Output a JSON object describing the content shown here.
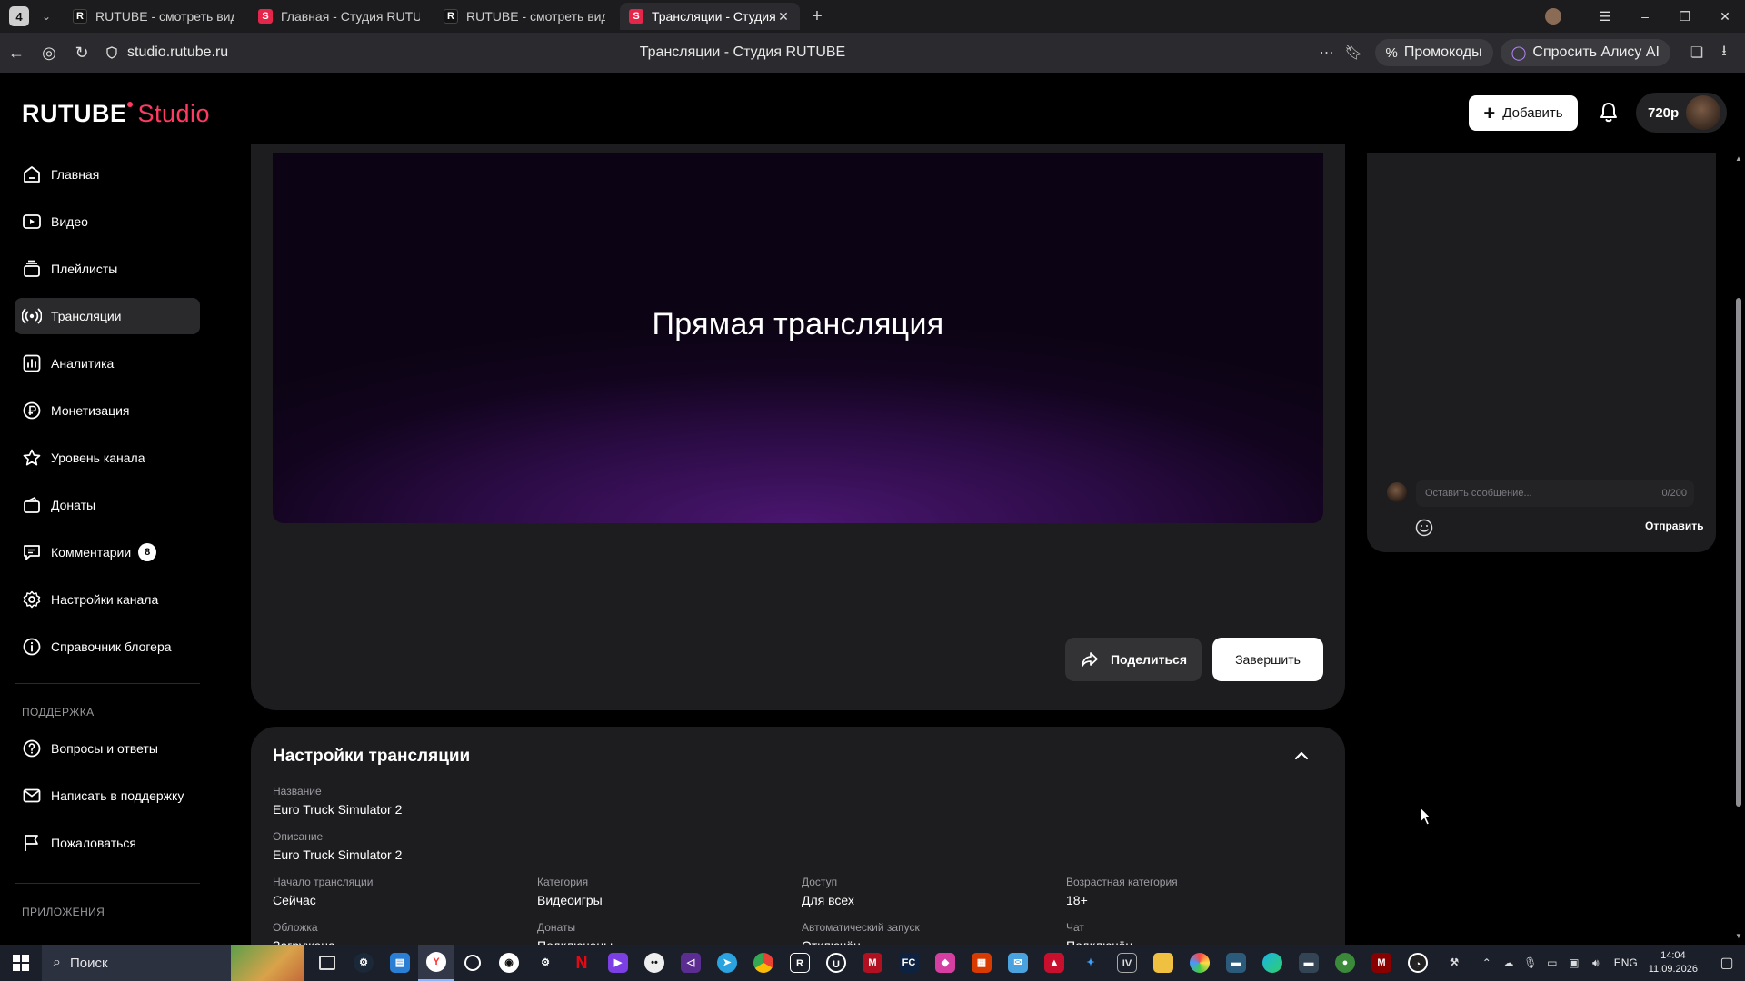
{
  "browser": {
    "tab_count": "4",
    "tabs": [
      {
        "label": "RUTUBE - смотреть виде",
        "favicon": "rutube"
      },
      {
        "label": "Главная - Студия RUTUBE",
        "favicon": "studio"
      },
      {
        "label": "RUTUBE - смотреть виде",
        "favicon": "rutube"
      },
      {
        "label": "Трансляции - Студия R",
        "favicon": "studio",
        "active": true
      }
    ],
    "url": "studio.rutube.ru",
    "page_title": "Трансляции - Студия RUTUBE",
    "promo_label": "Промокоды",
    "alice_label": "Спросить Алису AI"
  },
  "header": {
    "logo_text": "RUTUBE",
    "logo_suffix": "Studio",
    "add_label": "Добавить",
    "level_label": "720p"
  },
  "sidebar": {
    "items": [
      {
        "label": "Главная",
        "icon": "home-icon"
      },
      {
        "label": "Видео",
        "icon": "video-icon"
      },
      {
        "label": "Плейлисты",
        "icon": "playlist-icon"
      },
      {
        "label": "Трансляции",
        "icon": "broadcast-icon",
        "active": true
      },
      {
        "label": "Аналитика",
        "icon": "analytics-icon"
      },
      {
        "label": "Монетизация",
        "icon": "ruble-icon"
      },
      {
        "label": "Уровень канала",
        "icon": "star-icon"
      },
      {
        "label": "Донаты",
        "icon": "donate-icon"
      },
      {
        "label": "Комментарии",
        "icon": "comment-icon",
        "badge": "8"
      },
      {
        "label": "Настройки канала",
        "icon": "gear-icon"
      },
      {
        "label": "Справочник блогера",
        "icon": "info-icon"
      }
    ],
    "support_heading": "ПОДДЕРЖКА",
    "support_items": [
      {
        "label": "Вопросы и ответы",
        "icon": "question-icon"
      },
      {
        "label": "Написать в поддержку",
        "icon": "mail-icon"
      },
      {
        "label": "Пожаловаться",
        "icon": "flag-icon"
      }
    ],
    "apps_heading": "ПРИЛОЖЕНИЯ"
  },
  "player": {
    "video_label": "Прямая трансляция",
    "share_label": "Поделиться",
    "end_label": "Завершить"
  },
  "settings": {
    "title": "Настройки трансляции",
    "name_label": "Название",
    "name_value": "Euro Truck Simulator 2",
    "desc_label": "Описание",
    "desc_value": "Euro Truck Simulator 2",
    "grid": [
      {
        "label": "Начало трансляции",
        "value": "Сейчас"
      },
      {
        "label": "Категория",
        "value": "Видеоигры"
      },
      {
        "label": "Доступ",
        "value": "Для всех"
      },
      {
        "label": "Возрастная категория",
        "value": "18+"
      },
      {
        "label": "Обложка",
        "value": "Загружена"
      },
      {
        "label": "Донаты",
        "value": "Подключены"
      },
      {
        "label": "Автоматический запуск",
        "value": "Отключён"
      },
      {
        "label": "Чат",
        "value": "Подключён"
      }
    ]
  },
  "chat": {
    "input_placeholder": "Оставить сообщение...",
    "char_counter": "0/200",
    "send_label": "Отправить"
  },
  "taskbar": {
    "search_label": "Поиск",
    "lang": "ENG",
    "time": "14:04",
    "date": "11.09.2026"
  },
  "colors": {
    "accent": "#ff3b63",
    "background": "#000000",
    "card": "#1d1d20",
    "active_item": "#2a2a2d"
  }
}
